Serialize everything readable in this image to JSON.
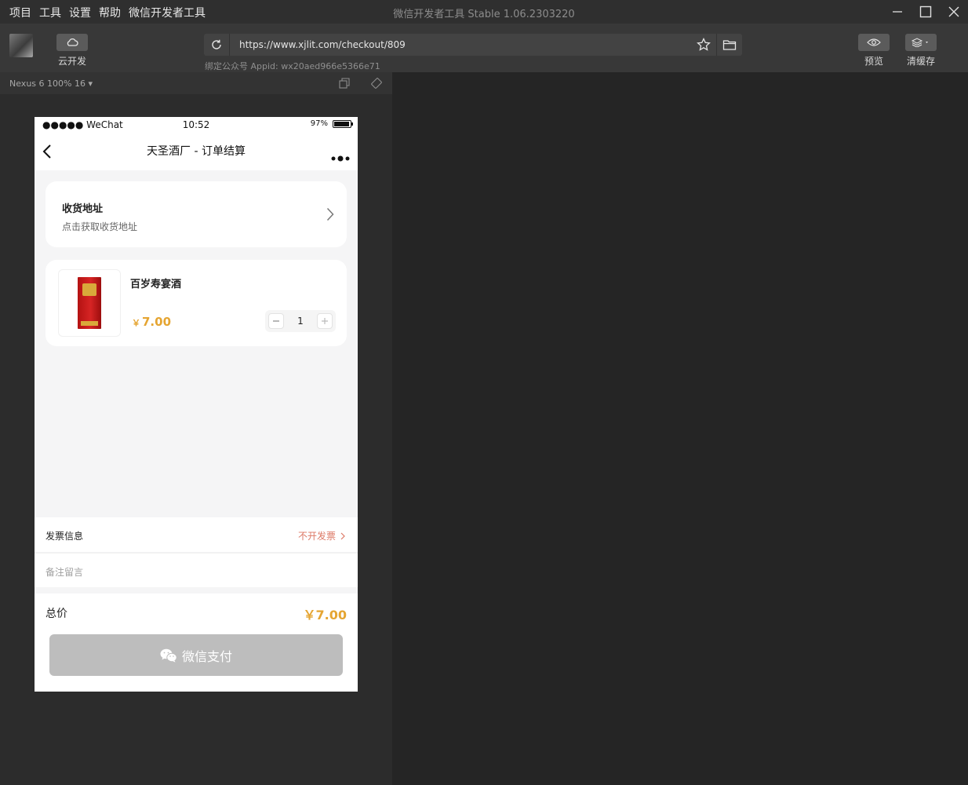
{
  "window": {
    "title": "微信开发者工具 Stable 1.06.2303220",
    "menu": [
      "项目",
      "工具",
      "设置",
      "帮助",
      "微信开发者工具"
    ]
  },
  "toolbar": {
    "cloud_label": "云开发",
    "url": "https://www.xjlit.com/checkout/809",
    "appid": "绑定公众号 Appid: wx20aed966e5366e71",
    "preview_label": "预览",
    "clear_cache_label": "清缓存"
  },
  "simulator": {
    "device": "Nexus 6 100% 16 ▾"
  },
  "phone": {
    "status": {
      "carrier": "●●●●● WeChat",
      "time": "10:52",
      "battery": "97%",
      "battery_level": 0.97
    },
    "nav_title": "天圣酒厂 - 订单结算",
    "address": {
      "title": "收货地址",
      "subtitle": "点击获取收货地址"
    },
    "goods": {
      "name": "百岁寿宴酒",
      "currency": "￥",
      "price": "7.00",
      "quantity": "1"
    },
    "invoice": {
      "label": "发票信息",
      "value": "不开发票"
    },
    "remark_placeholder": "备注留言",
    "total": {
      "label": "总价",
      "value": "￥7.00"
    },
    "pay_button": "微信支付"
  },
  "colors": {
    "price": "#e5a532",
    "invoice_value": "#dd7966",
    "pay_disabled": "#bdbdbd"
  }
}
